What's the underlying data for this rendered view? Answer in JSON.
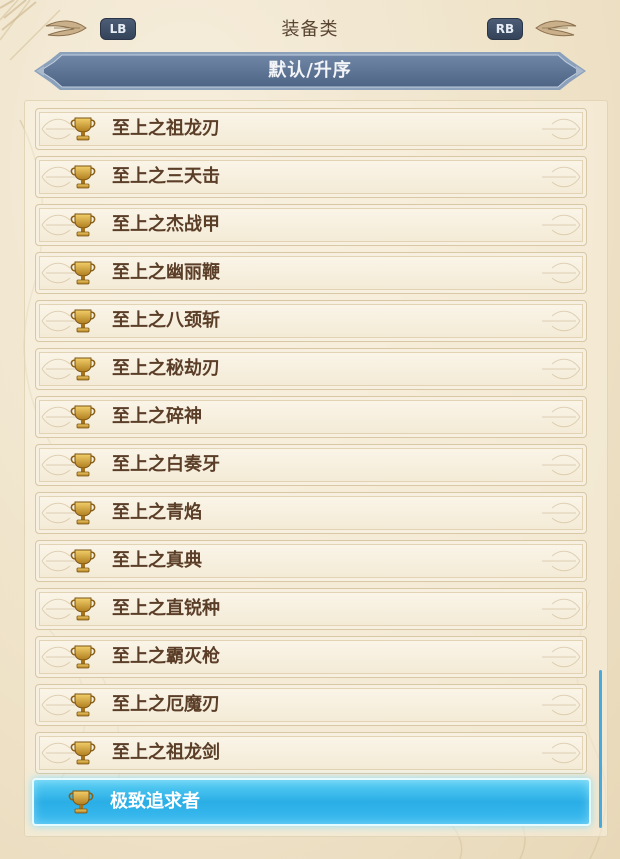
{
  "header": {
    "title": "装备类",
    "lb_label": "LB",
    "rb_label": "RB"
  },
  "sort": {
    "label": "默认/升序"
  },
  "colors": {
    "banner": "#5a7190",
    "selected": "#2aaee6",
    "text": "#5b3e28",
    "trophy": "#d9a632"
  },
  "items": [
    {
      "label": "至上之祖龙刃",
      "icon": "trophy-icon"
    },
    {
      "label": "至上之三天击",
      "icon": "trophy-icon"
    },
    {
      "label": "至上之杰战甲",
      "icon": "trophy-icon"
    },
    {
      "label": "至上之幽丽鞭",
      "icon": "trophy-icon"
    },
    {
      "label": "至上之八颈斩",
      "icon": "trophy-icon"
    },
    {
      "label": "至上之秘劫刃",
      "icon": "trophy-icon"
    },
    {
      "label": "至上之碎神",
      "icon": "trophy-icon"
    },
    {
      "label": "至上之白奏牙",
      "icon": "trophy-icon"
    },
    {
      "label": "至上之青焰",
      "icon": "trophy-icon"
    },
    {
      "label": "至上之真典",
      "icon": "trophy-icon"
    },
    {
      "label": "至上之直锐种",
      "icon": "trophy-icon"
    },
    {
      "label": "至上之霸灭枪",
      "icon": "trophy-icon"
    },
    {
      "label": "至上之厄魔刃",
      "icon": "trophy-icon"
    },
    {
      "label": "至上之祖龙剑",
      "icon": "trophy-icon"
    },
    {
      "label": "极致追求者",
      "icon": "trophy-icon",
      "selected": true
    }
  ]
}
